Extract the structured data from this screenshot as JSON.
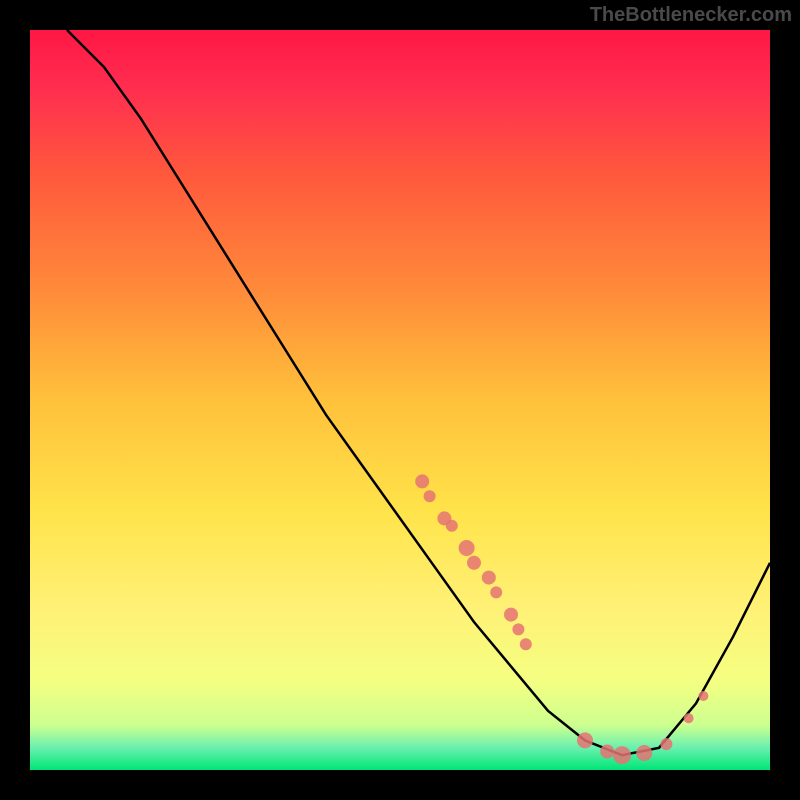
{
  "watermark": "TheBottlenecker.com",
  "chart_data": {
    "type": "line",
    "title": "",
    "xlabel": "",
    "ylabel": "",
    "xlim": [
      0,
      100
    ],
    "ylim": [
      0,
      100
    ],
    "gradient_stops": [
      {
        "offset": 0,
        "color": "#ff1744"
      },
      {
        "offset": 25,
        "color": "#ff6d3a"
      },
      {
        "offset": 50,
        "color": "#ffd740"
      },
      {
        "offset": 70,
        "color": "#ffee58"
      },
      {
        "offset": 85,
        "color": "#f4ff81"
      },
      {
        "offset": 97,
        "color": "#b9f6ca"
      },
      {
        "offset": 100,
        "color": "#00e676"
      }
    ],
    "curve_points": [
      {
        "x": 5,
        "y": 100
      },
      {
        "x": 10,
        "y": 95
      },
      {
        "x": 15,
        "y": 88
      },
      {
        "x": 20,
        "y": 80
      },
      {
        "x": 25,
        "y": 72
      },
      {
        "x": 30,
        "y": 64
      },
      {
        "x": 35,
        "y": 56
      },
      {
        "x": 40,
        "y": 48
      },
      {
        "x": 45,
        "y": 41
      },
      {
        "x": 50,
        "y": 34
      },
      {
        "x": 55,
        "y": 27
      },
      {
        "x": 60,
        "y": 20
      },
      {
        "x": 65,
        "y": 14
      },
      {
        "x": 70,
        "y": 8
      },
      {
        "x": 75,
        "y": 4
      },
      {
        "x": 80,
        "y": 2
      },
      {
        "x": 85,
        "y": 3
      },
      {
        "x": 90,
        "y": 9
      },
      {
        "x": 95,
        "y": 18
      },
      {
        "x": 100,
        "y": 28
      }
    ],
    "dot_clusters": [
      {
        "x": 53,
        "y": 39,
        "r": 7
      },
      {
        "x": 54,
        "y": 37,
        "r": 6
      },
      {
        "x": 56,
        "y": 34,
        "r": 7
      },
      {
        "x": 57,
        "y": 33,
        "r": 6
      },
      {
        "x": 59,
        "y": 30,
        "r": 8
      },
      {
        "x": 60,
        "y": 28,
        "r": 7
      },
      {
        "x": 62,
        "y": 26,
        "r": 7
      },
      {
        "x": 63,
        "y": 24,
        "r": 6
      },
      {
        "x": 65,
        "y": 21,
        "r": 7
      },
      {
        "x": 66,
        "y": 19,
        "r": 6
      },
      {
        "x": 67,
        "y": 17,
        "r": 6
      },
      {
        "x": 75,
        "y": 4,
        "r": 8
      },
      {
        "x": 78,
        "y": 2.5,
        "r": 7
      },
      {
        "x": 80,
        "y": 2,
        "r": 9
      },
      {
        "x": 83,
        "y": 2.3,
        "r": 8
      },
      {
        "x": 86,
        "y": 3.5,
        "r": 6
      },
      {
        "x": 89,
        "y": 7,
        "r": 5
      },
      {
        "x": 91,
        "y": 10,
        "r": 5
      }
    ]
  }
}
